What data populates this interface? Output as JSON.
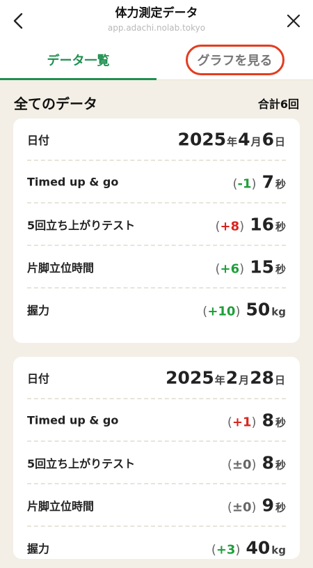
{
  "header": {
    "title": "体力測定データ",
    "url": "app.adachi.nolab.tokyo",
    "back_icon": "chevron-left-icon",
    "close_icon": "close-icon"
  },
  "tabs": [
    {
      "label": "データ一覧",
      "active": true
    },
    {
      "label": "グラフを見る",
      "active": false
    }
  ],
  "section": {
    "title": "全てのデータ",
    "count": "合計6回"
  },
  "records": [
    {
      "date_label": "日付",
      "date": {
        "year": "2025",
        "year_suffix": "年",
        "month": "4",
        "month_suffix": "月",
        "day": "6",
        "day_suffix": "日"
      },
      "metrics": [
        {
          "label": "Timed up & go",
          "diff": "-1",
          "diff_color": "#1f9f3a",
          "value": "7",
          "unit": "秒"
        },
        {
          "label": "5回立ち上がりテスト",
          "diff": "+8",
          "diff_color": "#d9241e",
          "value": "16",
          "unit": "秒"
        },
        {
          "label": "片脚立位時間",
          "diff": "+6",
          "diff_color": "#1f9f3a",
          "value": "15",
          "unit": "秒"
        },
        {
          "label": "握力",
          "diff": "+10",
          "diff_color": "#1f9f3a",
          "value": "50",
          "unit": "kg"
        }
      ]
    },
    {
      "date_label": "日付",
      "date": {
        "year": "2025",
        "year_suffix": "年",
        "month": "2",
        "month_suffix": "月",
        "day": "28",
        "day_suffix": "日"
      },
      "metrics": [
        {
          "label": "Timed up & go",
          "diff": "+1",
          "diff_color": "#d9241e",
          "value": "8",
          "unit": "秒"
        },
        {
          "label": "5回立ち上がりテスト",
          "diff": "±0",
          "diff_color": "#666666",
          "value": "8",
          "unit": "秒"
        },
        {
          "label": "片脚立位時間",
          "diff": "±0",
          "diff_color": "#666666",
          "value": "9",
          "unit": "秒"
        },
        {
          "label": "握力",
          "diff": "+3",
          "diff_color": "#1f9f3a",
          "value": "40",
          "unit": "kg"
        }
      ]
    }
  ],
  "colors": {
    "accent": "#1f8f4f",
    "highlight_ring": "#e43c1f",
    "background": "#f3efe6"
  }
}
